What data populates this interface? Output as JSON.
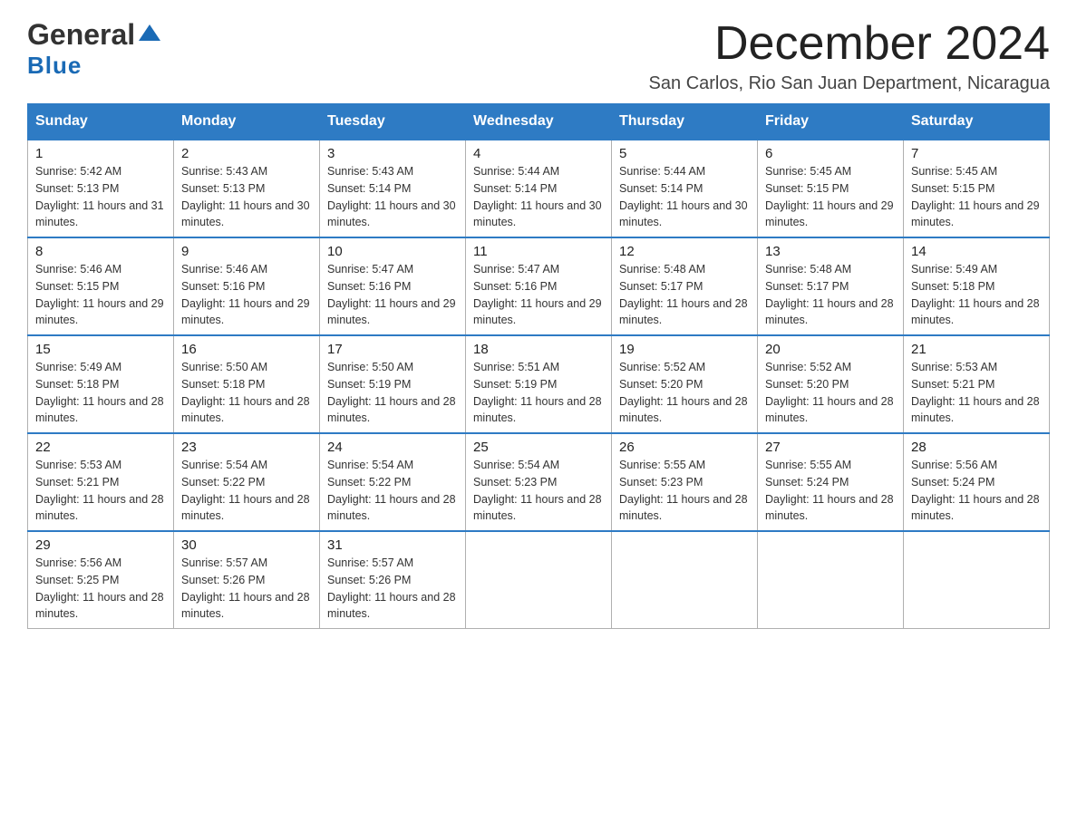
{
  "header": {
    "logo_general": "General",
    "logo_blue": "Blue",
    "month_year": "December 2024",
    "location": "San Carlos, Rio San Juan Department, Nicaragua"
  },
  "days_of_week": [
    "Sunday",
    "Monday",
    "Tuesday",
    "Wednesday",
    "Thursday",
    "Friday",
    "Saturday"
  ],
  "weeks": [
    [
      {
        "day": "1",
        "sunrise": "5:42 AM",
        "sunset": "5:13 PM",
        "daylight": "11 hours and 31 minutes."
      },
      {
        "day": "2",
        "sunrise": "5:43 AM",
        "sunset": "5:13 PM",
        "daylight": "11 hours and 30 minutes."
      },
      {
        "day": "3",
        "sunrise": "5:43 AM",
        "sunset": "5:14 PM",
        "daylight": "11 hours and 30 minutes."
      },
      {
        "day": "4",
        "sunrise": "5:44 AM",
        "sunset": "5:14 PM",
        "daylight": "11 hours and 30 minutes."
      },
      {
        "day": "5",
        "sunrise": "5:44 AM",
        "sunset": "5:14 PM",
        "daylight": "11 hours and 30 minutes."
      },
      {
        "day": "6",
        "sunrise": "5:45 AM",
        "sunset": "5:15 PM",
        "daylight": "11 hours and 29 minutes."
      },
      {
        "day": "7",
        "sunrise": "5:45 AM",
        "sunset": "5:15 PM",
        "daylight": "11 hours and 29 minutes."
      }
    ],
    [
      {
        "day": "8",
        "sunrise": "5:46 AM",
        "sunset": "5:15 PM",
        "daylight": "11 hours and 29 minutes."
      },
      {
        "day": "9",
        "sunrise": "5:46 AM",
        "sunset": "5:16 PM",
        "daylight": "11 hours and 29 minutes."
      },
      {
        "day": "10",
        "sunrise": "5:47 AM",
        "sunset": "5:16 PM",
        "daylight": "11 hours and 29 minutes."
      },
      {
        "day": "11",
        "sunrise": "5:47 AM",
        "sunset": "5:16 PM",
        "daylight": "11 hours and 29 minutes."
      },
      {
        "day": "12",
        "sunrise": "5:48 AM",
        "sunset": "5:17 PM",
        "daylight": "11 hours and 28 minutes."
      },
      {
        "day": "13",
        "sunrise": "5:48 AM",
        "sunset": "5:17 PM",
        "daylight": "11 hours and 28 minutes."
      },
      {
        "day": "14",
        "sunrise": "5:49 AM",
        "sunset": "5:18 PM",
        "daylight": "11 hours and 28 minutes."
      }
    ],
    [
      {
        "day": "15",
        "sunrise": "5:49 AM",
        "sunset": "5:18 PM",
        "daylight": "11 hours and 28 minutes."
      },
      {
        "day": "16",
        "sunrise": "5:50 AM",
        "sunset": "5:18 PM",
        "daylight": "11 hours and 28 minutes."
      },
      {
        "day": "17",
        "sunrise": "5:50 AM",
        "sunset": "5:19 PM",
        "daylight": "11 hours and 28 minutes."
      },
      {
        "day": "18",
        "sunrise": "5:51 AM",
        "sunset": "5:19 PM",
        "daylight": "11 hours and 28 minutes."
      },
      {
        "day": "19",
        "sunrise": "5:52 AM",
        "sunset": "5:20 PM",
        "daylight": "11 hours and 28 minutes."
      },
      {
        "day": "20",
        "sunrise": "5:52 AM",
        "sunset": "5:20 PM",
        "daylight": "11 hours and 28 minutes."
      },
      {
        "day": "21",
        "sunrise": "5:53 AM",
        "sunset": "5:21 PM",
        "daylight": "11 hours and 28 minutes."
      }
    ],
    [
      {
        "day": "22",
        "sunrise": "5:53 AM",
        "sunset": "5:21 PM",
        "daylight": "11 hours and 28 minutes."
      },
      {
        "day": "23",
        "sunrise": "5:54 AM",
        "sunset": "5:22 PM",
        "daylight": "11 hours and 28 minutes."
      },
      {
        "day": "24",
        "sunrise": "5:54 AM",
        "sunset": "5:22 PM",
        "daylight": "11 hours and 28 minutes."
      },
      {
        "day": "25",
        "sunrise": "5:54 AM",
        "sunset": "5:23 PM",
        "daylight": "11 hours and 28 minutes."
      },
      {
        "day": "26",
        "sunrise": "5:55 AM",
        "sunset": "5:23 PM",
        "daylight": "11 hours and 28 minutes."
      },
      {
        "day": "27",
        "sunrise": "5:55 AM",
        "sunset": "5:24 PM",
        "daylight": "11 hours and 28 minutes."
      },
      {
        "day": "28",
        "sunrise": "5:56 AM",
        "sunset": "5:24 PM",
        "daylight": "11 hours and 28 minutes."
      }
    ],
    [
      {
        "day": "29",
        "sunrise": "5:56 AM",
        "sunset": "5:25 PM",
        "daylight": "11 hours and 28 minutes."
      },
      {
        "day": "30",
        "sunrise": "5:57 AM",
        "sunset": "5:26 PM",
        "daylight": "11 hours and 28 minutes."
      },
      {
        "day": "31",
        "sunrise": "5:57 AM",
        "sunset": "5:26 PM",
        "daylight": "11 hours and 28 minutes."
      },
      null,
      null,
      null,
      null
    ]
  ],
  "labels": {
    "sunrise": "Sunrise:",
    "sunset": "Sunset:",
    "daylight": "Daylight:"
  }
}
